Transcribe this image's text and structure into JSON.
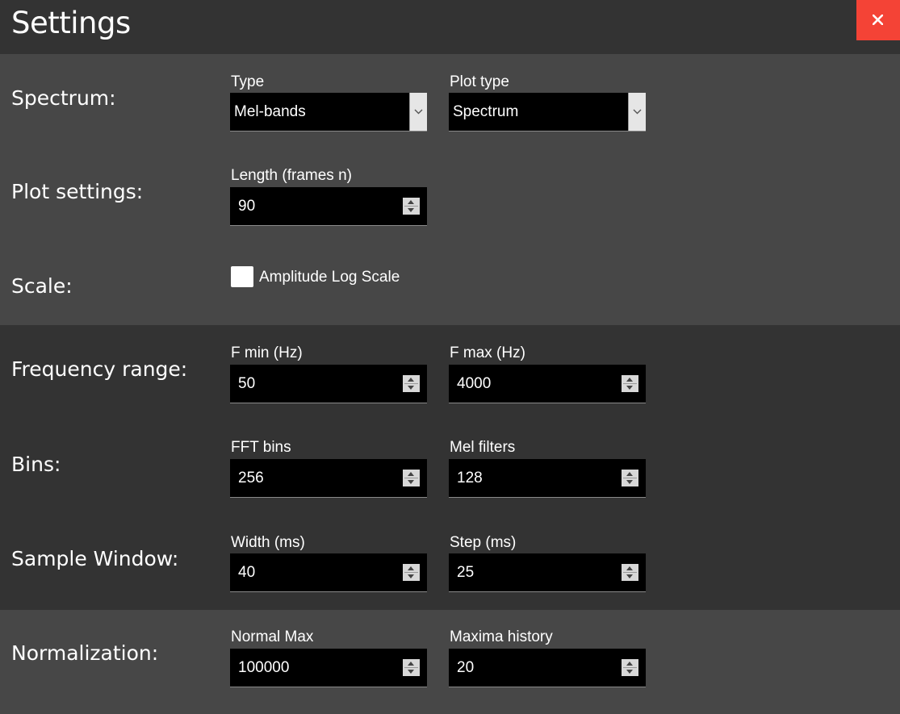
{
  "header": {
    "title": "Settings"
  },
  "rows": {
    "spectrum": {
      "label": "Spectrum:",
      "type": {
        "label": "Type",
        "value": "Mel-bands"
      },
      "plot_type": {
        "label": "Plot type",
        "value": "Spectrum"
      }
    },
    "plot_settings": {
      "label": "Plot settings:",
      "length": {
        "label": "Length (frames n)",
        "value": "90"
      }
    },
    "scale": {
      "label": "Scale:",
      "amplitude_log": {
        "label": "Amplitude Log Scale",
        "checked": false
      }
    },
    "frequency_range": {
      "label": "Frequency range:",
      "fmin": {
        "label": "F min (Hz)",
        "value": "50"
      },
      "fmax": {
        "label": "F max (Hz)",
        "value": "4000"
      }
    },
    "bins": {
      "label": "Bins:",
      "fft_bins": {
        "label": "FFT bins",
        "value": "256"
      },
      "mel_filters": {
        "label": "Mel filters",
        "value": "128"
      }
    },
    "sample_window": {
      "label": "Sample Window:",
      "width": {
        "label": "Width (ms)",
        "value": "40"
      },
      "step": {
        "label": "Step (ms)",
        "value": "25"
      }
    },
    "normalization": {
      "label": "Normalization:",
      "normal_max": {
        "label": "Normal Max",
        "value": "100000"
      },
      "maxima_history": {
        "label": "Maxima history",
        "value": "20"
      }
    }
  },
  "icons": {
    "close": "close-icon",
    "dropdown": "chevron-down-icon",
    "spinner": "spinner-arrows-icon"
  },
  "colors": {
    "close_button": "#f44336",
    "titlebar": "#333333",
    "section_light": "#474747",
    "section_dark": "#333333",
    "field_bg": "#000000"
  }
}
